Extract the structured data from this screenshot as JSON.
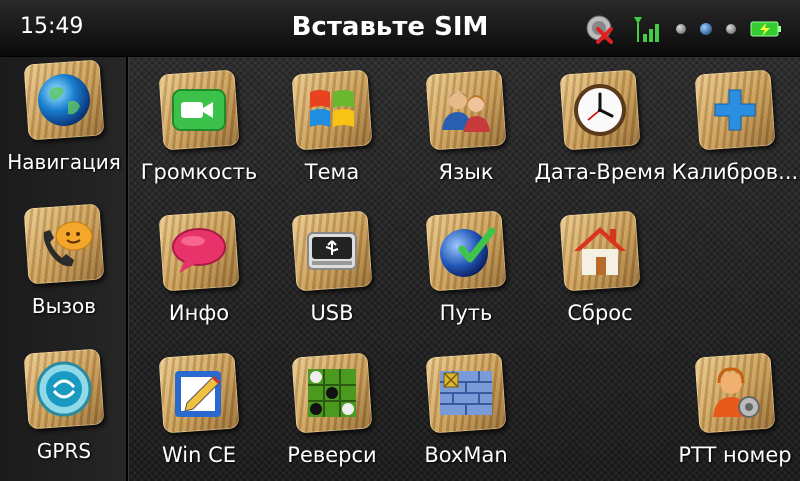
{
  "statusbar": {
    "time": "15:49",
    "title": "Вставьте SIM",
    "icons": [
      "gps-disabled-icon",
      "signal-icon",
      "status-dot-icon",
      "bluetooth-dot-icon",
      "status-dot-icon",
      "battery-charging-icon"
    ]
  },
  "sidebar": {
    "items": [
      {
        "label": "Навигация",
        "icon": "globe-icon"
      },
      {
        "label": "Вызов",
        "icon": "phone-chat-icon"
      },
      {
        "label": "GPRS",
        "icon": "gprs-globe-icon"
      }
    ]
  },
  "grid": {
    "row1": [
      {
        "label": "Громкость",
        "icon": "video-camera-icon"
      },
      {
        "label": "Тема",
        "icon": "windows-flag-icon"
      },
      {
        "label": "Язык",
        "icon": "people-icon"
      },
      {
        "label": "Дата-Время",
        "icon": "clock-icon"
      },
      {
        "label": "Калибров...",
        "icon": "plus-icon"
      }
    ],
    "row2": [
      {
        "label": "Инфо",
        "icon": "speech-bubble-icon"
      },
      {
        "label": "USB",
        "icon": "usb-drive-icon"
      },
      {
        "label": "Путь",
        "icon": "globe-check-icon"
      },
      {
        "label": "Сброс",
        "icon": "house-icon"
      }
    ],
    "row3": [
      {
        "label": "Win CE",
        "icon": "winc-pencil-icon"
      },
      {
        "label": "Реверси",
        "icon": "reversi-board-icon"
      },
      {
        "label": "BoxMan",
        "icon": "brick-wall-icon"
      },
      {
        "label": "PTT номер",
        "icon": "operator-headset-icon"
      }
    ]
  },
  "colors": {
    "accent_blue": "#2a7fd6",
    "wood": "#c69a55",
    "green": "#3bb54a"
  }
}
